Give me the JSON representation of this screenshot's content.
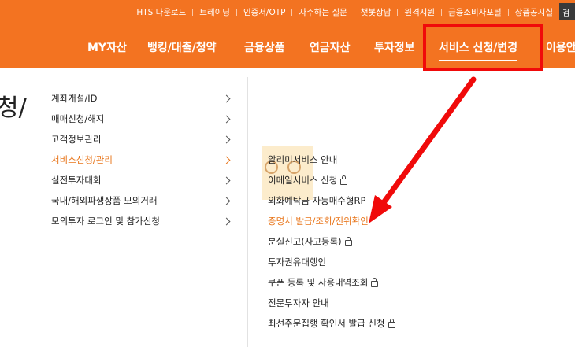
{
  "topbar": {
    "links": [
      "HTS 다운로드",
      "트레이딩",
      "인증서/OTP",
      "자주하는 질문",
      "챗봇상담",
      "원격지원",
      "금융소비자포털",
      "상품공시실"
    ],
    "box_text": "검"
  },
  "mainnav": {
    "items": [
      "MY자산",
      "뱅킹/대출/청약",
      "금융상품",
      "연금자산",
      "투자정보",
      "서비스 신청/변경",
      "이용안"
    ]
  },
  "page": {
    "fragment": "청/"
  },
  "left_menu": {
    "items": [
      "계좌개설/ID",
      "매매신청/해지",
      "고객정보관리",
      "서비스신청/관리",
      "실전투자대회",
      "국내/해외파생상품 모의거래",
      "모의투자 로그인 및 참가신청"
    ],
    "active_index": 3
  },
  "sub_menu": {
    "items": [
      {
        "label": "알리미서비스 안내",
        "lock": false
      },
      {
        "label": "이메일서비스 신청",
        "lock": true
      },
      {
        "label": "외화예탁금 자동매수형RP",
        "lock": false
      },
      {
        "label": "증명서 발급/조회/진위확인",
        "lock": false
      },
      {
        "label": "분실신고(사고등록)",
        "lock": true
      },
      {
        "label": "투자권유대행인",
        "lock": false
      },
      {
        "label": "쿠폰 등록 및 사용내역조회",
        "lock": true
      },
      {
        "label": "전문투자자 안내",
        "lock": false
      },
      {
        "label": "최선주문집행 확인서 발급 신청",
        "lock": true
      }
    ],
    "active_index": 3
  },
  "colors": {
    "brand_orange": "#f37321",
    "active_text": "#e8751a",
    "annotation_red": "#f00a0a"
  },
  "icons": {
    "menu_arrow": "chevron-right-icon",
    "lock": "lock-icon"
  }
}
